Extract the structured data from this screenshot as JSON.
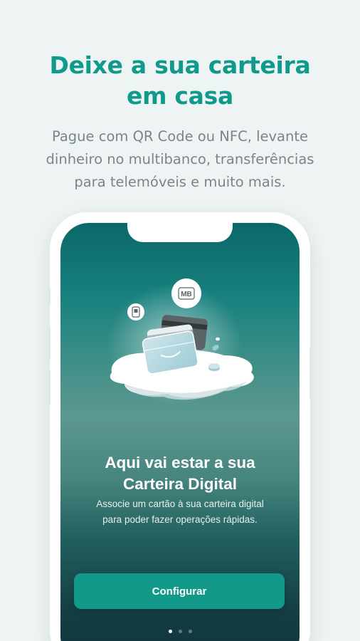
{
  "headline": {
    "line1": "Deixe a sua carteira",
    "line2": "em casa"
  },
  "subtext": {
    "line1": "Pague com QR Code ou NFC, levante",
    "line2": "dinheiro no multibanco, transferências",
    "line3": "para telemóveis e muito mais."
  },
  "phone_screen": {
    "title_line1": "Aqui vai estar a sua",
    "title_line2": "Carteira Digital",
    "desc_line1": "Associe um cartão à sua carteira digital",
    "desc_line2": "para poder fazer operações rápidas.",
    "cta_label": "Configurar",
    "badge_label": "MB",
    "pagination": {
      "total": 3,
      "active": 1
    }
  },
  "colors": {
    "accent": "#0f9a8c",
    "background": "#eef4f4",
    "button": "#13998a"
  }
}
